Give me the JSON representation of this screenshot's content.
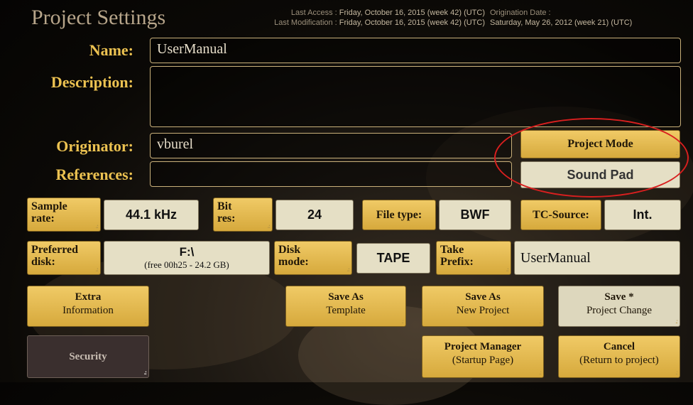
{
  "header": {
    "title": "Project Settings",
    "last_access_label": "Last Access :",
    "last_access_value": "Friday, October 16, 2015 (week 42) (UTC)",
    "last_mod_label": "Last Modification :",
    "last_mod_value": "Friday, October 16, 2015 (week 42) (UTC)",
    "origination_label": "Origination Date :",
    "origination_value": "Saturday, May 26, 2012 (week 21) (UTC)"
  },
  "fields": {
    "name_label": "Name:",
    "name_value": "UserManual",
    "description_label": "Description:",
    "description_value": "",
    "originator_label": "Originator:",
    "originator_value": "vburel",
    "references_label": "References:",
    "references_value": ""
  },
  "mode": {
    "label": "Project Mode",
    "value": "Sound Pad"
  },
  "params": {
    "sample_rate_label_1": "Sample",
    "sample_rate_label_2": "rate:",
    "sample_rate_value": "44.1 kHz",
    "bit_res_label_1": "Bit",
    "bit_res_label_2": "res:",
    "bit_res_value": "24",
    "file_type_label": "File type:",
    "file_type_value": "BWF",
    "tc_source_label": "TC-Source:",
    "tc_source_value": "Int.",
    "preferred_disk_label_1": "Preferred",
    "preferred_disk_label_2": "disk:",
    "preferred_disk_value": "F:\\",
    "preferred_disk_free": "(free 00h25 - 24.2 GB)",
    "disk_mode_label_1": "Disk",
    "disk_mode_label_2": "mode:",
    "disk_mode_value": "TAPE",
    "take_prefix_label_1": "Take",
    "take_prefix_label_2": "Prefix:",
    "take_prefix_value": "UserManual"
  },
  "buttons": {
    "extra_1": "Extra",
    "extra_2": "Information",
    "save_template_1": "Save As",
    "save_template_2": "Template",
    "save_new_1": "Save As",
    "save_new_2": "New Project",
    "save_change_1": "Save *",
    "save_change_2": "Project Change",
    "security": "Security",
    "manager_1": "Project Manager",
    "manager_2": "(Startup Page)",
    "cancel_1": "Cancel",
    "cancel_2": "(Return to project)"
  },
  "colors": {
    "gold": "#ecc251",
    "button_gold": "#e3b74f",
    "value_bg": "#e5dfc5",
    "highlight_oval": "#d81f1f"
  }
}
